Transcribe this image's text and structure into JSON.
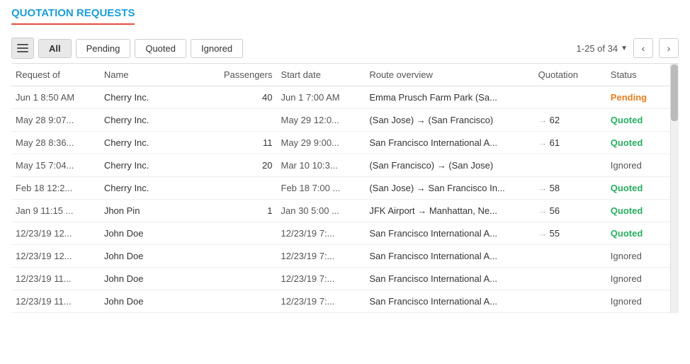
{
  "page": {
    "title": "QUOTATION REQUESTS"
  },
  "toolbar": {
    "menu_label": "menu",
    "tabs": [
      {
        "id": "all",
        "label": "All",
        "active": true
      },
      {
        "id": "pending",
        "label": "Pending",
        "active": false
      },
      {
        "id": "quoted",
        "label": "Quoted",
        "active": false
      },
      {
        "id": "ignored",
        "label": "Ignored",
        "active": false
      }
    ],
    "pagination": {
      "range": "1-25 of 34"
    },
    "prev_label": "‹",
    "next_label": "›"
  },
  "table": {
    "columns": [
      {
        "id": "request_of",
        "label": "Request of"
      },
      {
        "id": "name",
        "label": "Name"
      },
      {
        "id": "passengers",
        "label": "Passengers"
      },
      {
        "id": "start_date",
        "label": "Start date"
      },
      {
        "id": "route_overview",
        "label": "Route overview"
      },
      {
        "id": "quotation",
        "label": "Quotation"
      },
      {
        "id": "status",
        "label": "Status"
      }
    ],
    "rows": [
      {
        "request_of": "Jun 1 8:50 AM",
        "name": "Cherry Inc.",
        "passengers": "40",
        "start_date": "Jun 1 7:00 AM",
        "route": "Emma Prusch Farm Park (Sa...",
        "quotation": "",
        "quotation_num": "",
        "status": "Pending",
        "status_class": "status-pending"
      },
      {
        "request_of": "May 28 9:07...",
        "name": "Cherry Inc.",
        "passengers": "",
        "start_date": "May 29 12:0...",
        "route": "(San Jose) → (San Francisco)",
        "quotation": "62",
        "quotation_num": "62",
        "status": "Quoted",
        "status_class": "status-quoted"
      },
      {
        "request_of": "May 28 8:36...",
        "name": "Cherry Inc.",
        "passengers": "11",
        "start_date": "May 29 9:00...",
        "route": "San Francisco International A...",
        "quotation": "61",
        "quotation_num": "61",
        "status": "Quoted",
        "status_class": "status-quoted"
      },
      {
        "request_of": "May 15 7:04...",
        "name": "Cherry Inc.",
        "passengers": "20",
        "start_date": "Mar 10 10:3...",
        "route": "(San Francisco) → (San Jose)",
        "quotation": "",
        "quotation_num": "",
        "status": "Ignored",
        "status_class": "status-ignored"
      },
      {
        "request_of": "Feb 18 12:2...",
        "name": "Cherry Inc.",
        "passengers": "",
        "start_date": "Feb 18 7:00 ...",
        "route": "(San Jose) → San Francisco In...",
        "quotation": "58",
        "quotation_num": "58",
        "status": "Quoted",
        "status_class": "status-quoted"
      },
      {
        "request_of": "Jan 9 11:15 ...",
        "name": "Jhon Pin",
        "passengers": "1",
        "start_date": "Jan 30 5:00 ...",
        "route": "JFK Airport → Manhattan, Ne...",
        "quotation": "56",
        "quotation_num": "56",
        "status": "Quoted",
        "status_class": "status-quoted"
      },
      {
        "request_of": "12/23/19 12...",
        "name": "John Doe",
        "passengers": "",
        "start_date": "12/23/19 7:...",
        "route": "San Francisco International A...",
        "quotation": "55",
        "quotation_num": "55",
        "status": "Quoted",
        "status_class": "status-quoted"
      },
      {
        "request_of": "12/23/19 12...",
        "name": "John Doe",
        "passengers": "",
        "start_date": "12/23/19 7:...",
        "route": "San Francisco International A...",
        "quotation": "",
        "quotation_num": "",
        "status": "Ignored",
        "status_class": "status-ignored"
      },
      {
        "request_of": "12/23/19 11...",
        "name": "John Doe",
        "passengers": "",
        "start_date": "12/23/19 7:...",
        "route": "San Francisco International A...",
        "quotation": "",
        "quotation_num": "",
        "status": "Ignored",
        "status_class": "status-ignored"
      },
      {
        "request_of": "12/23/19 11...",
        "name": "John Doe",
        "passengers": "",
        "start_date": "12/23/19 7:...",
        "route": "San Francisco International A...",
        "quotation": "",
        "quotation_num": "",
        "status": "Ignored",
        "status_class": "status-ignored"
      }
    ]
  }
}
